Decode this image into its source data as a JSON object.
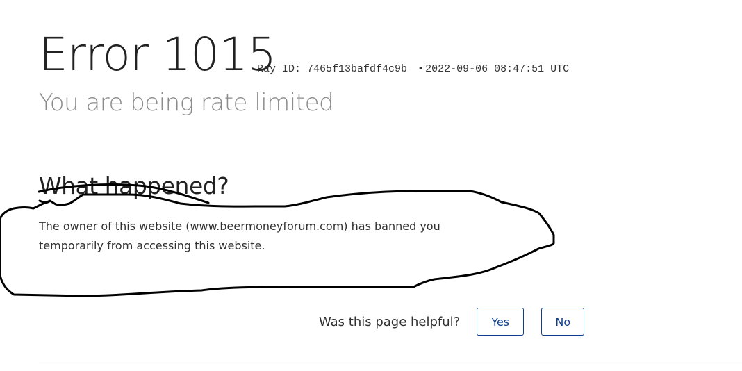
{
  "error": {
    "title": "Error 1015",
    "ray_id_label": "Ray ID:",
    "ray_id": "7465f13bafdf4c9b",
    "separator": "•",
    "timestamp": "2022-09-06 08:47:51 UTC",
    "subtitle": "You are being rate limited"
  },
  "what_happened": {
    "heading": "What happened?",
    "body": "The owner of this website (www.beermoneyforum.com) has banned you temporarily from accessing this website."
  },
  "feedback": {
    "question": "Was this page helpful?",
    "yes_label": "Yes",
    "no_label": "No"
  },
  "colors": {
    "button_accent": "#0e3e8a",
    "subtitle_gray": "#8c8c8c",
    "scribble": "#000000"
  }
}
